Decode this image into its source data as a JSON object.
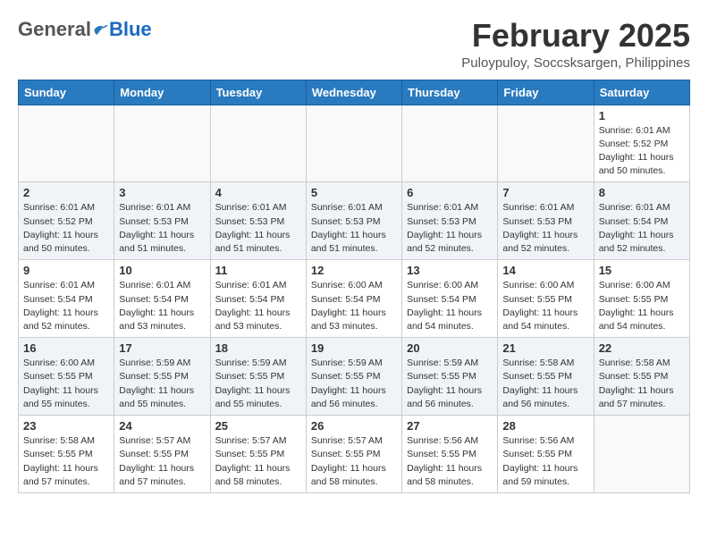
{
  "header": {
    "logo_general": "General",
    "logo_blue": "Blue",
    "title": "February 2025",
    "subtitle": "Puloypuloy, Soccsksargen, Philippines"
  },
  "weekdays": [
    "Sunday",
    "Monday",
    "Tuesday",
    "Wednesday",
    "Thursday",
    "Friday",
    "Saturday"
  ],
  "weeks": [
    [
      {
        "day": "",
        "info": ""
      },
      {
        "day": "",
        "info": ""
      },
      {
        "day": "",
        "info": ""
      },
      {
        "day": "",
        "info": ""
      },
      {
        "day": "",
        "info": ""
      },
      {
        "day": "",
        "info": ""
      },
      {
        "day": "1",
        "info": "Sunrise: 6:01 AM\nSunset: 5:52 PM\nDaylight: 11 hours\nand 50 minutes."
      }
    ],
    [
      {
        "day": "2",
        "info": "Sunrise: 6:01 AM\nSunset: 5:52 PM\nDaylight: 11 hours\nand 50 minutes."
      },
      {
        "day": "3",
        "info": "Sunrise: 6:01 AM\nSunset: 5:53 PM\nDaylight: 11 hours\nand 51 minutes."
      },
      {
        "day": "4",
        "info": "Sunrise: 6:01 AM\nSunset: 5:53 PM\nDaylight: 11 hours\nand 51 minutes."
      },
      {
        "day": "5",
        "info": "Sunrise: 6:01 AM\nSunset: 5:53 PM\nDaylight: 11 hours\nand 51 minutes."
      },
      {
        "day": "6",
        "info": "Sunrise: 6:01 AM\nSunset: 5:53 PM\nDaylight: 11 hours\nand 52 minutes."
      },
      {
        "day": "7",
        "info": "Sunrise: 6:01 AM\nSunset: 5:53 PM\nDaylight: 11 hours\nand 52 minutes."
      },
      {
        "day": "8",
        "info": "Sunrise: 6:01 AM\nSunset: 5:54 PM\nDaylight: 11 hours\nand 52 minutes."
      }
    ],
    [
      {
        "day": "9",
        "info": "Sunrise: 6:01 AM\nSunset: 5:54 PM\nDaylight: 11 hours\nand 52 minutes."
      },
      {
        "day": "10",
        "info": "Sunrise: 6:01 AM\nSunset: 5:54 PM\nDaylight: 11 hours\nand 53 minutes."
      },
      {
        "day": "11",
        "info": "Sunrise: 6:01 AM\nSunset: 5:54 PM\nDaylight: 11 hours\nand 53 minutes."
      },
      {
        "day": "12",
        "info": "Sunrise: 6:00 AM\nSunset: 5:54 PM\nDaylight: 11 hours\nand 53 minutes."
      },
      {
        "day": "13",
        "info": "Sunrise: 6:00 AM\nSunset: 5:54 PM\nDaylight: 11 hours\nand 54 minutes."
      },
      {
        "day": "14",
        "info": "Sunrise: 6:00 AM\nSunset: 5:55 PM\nDaylight: 11 hours\nand 54 minutes."
      },
      {
        "day": "15",
        "info": "Sunrise: 6:00 AM\nSunset: 5:55 PM\nDaylight: 11 hours\nand 54 minutes."
      }
    ],
    [
      {
        "day": "16",
        "info": "Sunrise: 6:00 AM\nSunset: 5:55 PM\nDaylight: 11 hours\nand 55 minutes."
      },
      {
        "day": "17",
        "info": "Sunrise: 5:59 AM\nSunset: 5:55 PM\nDaylight: 11 hours\nand 55 minutes."
      },
      {
        "day": "18",
        "info": "Sunrise: 5:59 AM\nSunset: 5:55 PM\nDaylight: 11 hours\nand 55 minutes."
      },
      {
        "day": "19",
        "info": "Sunrise: 5:59 AM\nSunset: 5:55 PM\nDaylight: 11 hours\nand 56 minutes."
      },
      {
        "day": "20",
        "info": "Sunrise: 5:59 AM\nSunset: 5:55 PM\nDaylight: 11 hours\nand 56 minutes."
      },
      {
        "day": "21",
        "info": "Sunrise: 5:58 AM\nSunset: 5:55 PM\nDaylight: 11 hours\nand 56 minutes."
      },
      {
        "day": "22",
        "info": "Sunrise: 5:58 AM\nSunset: 5:55 PM\nDaylight: 11 hours\nand 57 minutes."
      }
    ],
    [
      {
        "day": "23",
        "info": "Sunrise: 5:58 AM\nSunset: 5:55 PM\nDaylight: 11 hours\nand 57 minutes."
      },
      {
        "day": "24",
        "info": "Sunrise: 5:57 AM\nSunset: 5:55 PM\nDaylight: 11 hours\nand 57 minutes."
      },
      {
        "day": "25",
        "info": "Sunrise: 5:57 AM\nSunset: 5:55 PM\nDaylight: 11 hours\nand 58 minutes."
      },
      {
        "day": "26",
        "info": "Sunrise: 5:57 AM\nSunset: 5:55 PM\nDaylight: 11 hours\nand 58 minutes."
      },
      {
        "day": "27",
        "info": "Sunrise: 5:56 AM\nSunset: 5:55 PM\nDaylight: 11 hours\nand 58 minutes."
      },
      {
        "day": "28",
        "info": "Sunrise: 5:56 AM\nSunset: 5:55 PM\nDaylight: 11 hours\nand 59 minutes."
      },
      {
        "day": "",
        "info": ""
      }
    ]
  ]
}
